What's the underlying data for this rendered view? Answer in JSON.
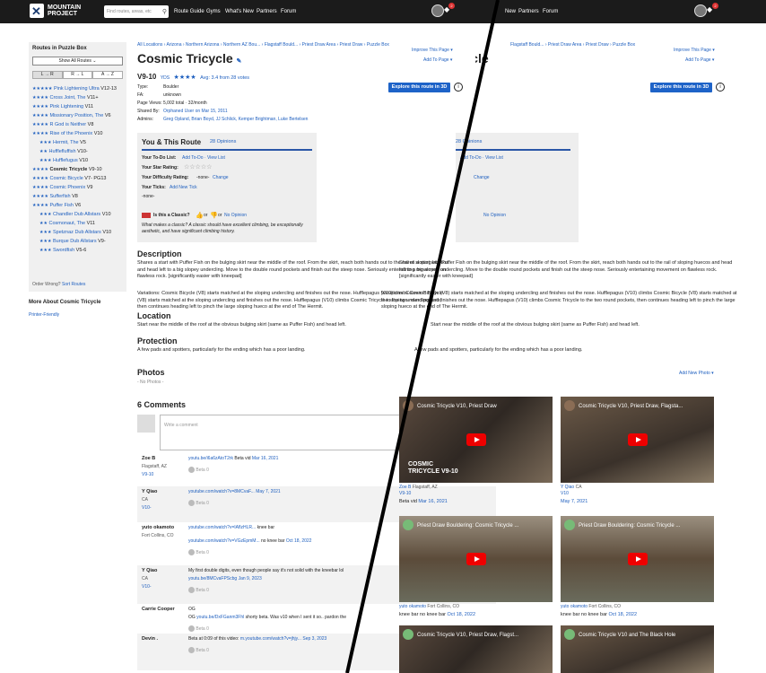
{
  "header": {
    "brand": [
      "MOUNTAIN",
      "PROJECT"
    ],
    "search_placeholder": "Find routes, areas, etc",
    "nav": [
      "Route Guide",
      "Gyms",
      "What's New",
      "Partners",
      "Forum"
    ],
    "nav_right": [
      "New",
      "Partners",
      "Forum"
    ],
    "notif_count": "2"
  },
  "sidebar": {
    "title": "Routes in Puzzle Box",
    "show_all": "Show All Routes",
    "sort_buttons": [
      "L → R",
      "R → L",
      "A → Z"
    ],
    "routes": [
      {
        "stars": "★★★★★",
        "name": "Pink Lightening Ultra",
        "grade": "V12-13"
      },
      {
        "stars": "★★★★",
        "name": "Cross Joint, The",
        "grade": "V11+"
      },
      {
        "stars": "★★★★",
        "name": "Pink Lightening",
        "grade": "V11"
      },
      {
        "stars": "★★★★",
        "name": "Missionary Position, The",
        "grade": "V6"
      },
      {
        "stars": "★★★★",
        "name": "R God is Neither",
        "grade": "V8"
      },
      {
        "stars": "★★★★",
        "name": "Rise of the Phoenix",
        "grade": "V10"
      },
      {
        "stars": "★★★",
        "name": "Hermit, The",
        "grade": "V5"
      },
      {
        "stars": "★★",
        "name": "Hufflefluffish",
        "grade": "V10-"
      },
      {
        "stars": "★★★",
        "name": "Hufflefugus",
        "grade": "V10"
      },
      {
        "stars": "★★★★",
        "name": "Cosmic Tricycle",
        "grade": "V9-10"
      },
      {
        "stars": "★★★★",
        "name": "Cosmic Bicycle",
        "grade": "V7- PG13"
      },
      {
        "stars": "★★★★",
        "name": "Cosmic Phoenix",
        "grade": "V9"
      },
      {
        "stars": "★★★★",
        "name": "Sufferfish",
        "grade": "V8"
      },
      {
        "stars": "★★★★",
        "name": "Puffer Fish",
        "grade": "V6"
      },
      {
        "stars": "★★★",
        "name": "Chandler Dub Allstars",
        "grade": "V10"
      },
      {
        "stars": "★★",
        "name": "Cosmonaut, The",
        "grade": "V11"
      },
      {
        "stars": "★★★",
        "name": "Spetznaz Dub Allstars",
        "grade": "V10"
      },
      {
        "stars": "★★★",
        "name": "Burque Dub Allstars",
        "grade": "V9-"
      },
      {
        "stars": "★★★",
        "name": "Swordfish",
        "grade": "V5-6"
      }
    ],
    "footer_text": "Order Wrong?",
    "footer_link": "Sort Routes",
    "more_about": "More About Cosmic Tricycle",
    "printer": "Printer-Friendly"
  },
  "breadcrumb": "All Locations › Arizona › Northern Arizona › Northern AZ Bou... › Flagstaff Bould... › Priest Draw Area › Priest Draw › Puzzle Box",
  "breadcrumb_right": "Flagstaff Bould... › Priest Draw Area › Priest Draw › Puzzle Box",
  "improve": "Improve This Page ▾",
  "add_to": "Add To Page ▾",
  "title": "Cosmic Tricycle",
  "grade": "V9-10",
  "grade_sys": "YDS",
  "rating": "★★★★",
  "avg": "Avg: 3.4 from 28 votes",
  "explore": "Explore this route in 3D",
  "info": {
    "labels": [
      "Type:",
      "FA:",
      "Page Views:",
      "Shared By:",
      "Admins:"
    ],
    "values": [
      "Boulder",
      "unknown",
      "5,002 total · 32/month",
      "Orphaned User on Mar 15, 2011",
      "Greg Opland, Brian Boyd, JJ Schlick, Kemper Brightman, Luke Bertelsen"
    ]
  },
  "you": {
    "title": "You & This Route",
    "opinions": "28 Opinions",
    "todo_label": "Your To-Do List:",
    "todo_link": "Add To-Do · View List",
    "star_label": "Your Star Rating:",
    "diff_label": "Your Difficulty Rating:",
    "diff_val": "-none-",
    "diff_link": "Change",
    "ticks_label": "Your Ticks:",
    "ticks_link": "Add New Tick",
    "ticks_val": "-none-",
    "classic_q": "Is this a Classic?",
    "or": "or",
    "no_opinion": "No Opinion",
    "classic_note": "What makes a classic? A classic should have excellent climbing, be exceptionally aesthetic, and have significant climbing history."
  },
  "description": {
    "heading": "Description",
    "p1": "Shares a start with Puffer Fish on the bulging skirt near the middle of the roof. From the skirt, reach both hands out to the rail of sloping huecos and head left to a big slopey undercling. Move to the double round pockets and finish out the steep nose. Seriously entertaining movement on flawless rock. [significantly easier with kneepad]",
    "p2": "Variations: Cosmic Bicycle (V8) starts matched at the sloping undercling and finishes out the nose. Hufflepagus (V10) climbs Cosmic Bicycle (V8) starts matched at the sloping undercling and finishes out the nose. Hufflepagus (V10) climbs Cosmic Tricycle to the two round pockets, then continues heading left to pinch the large sloping hueco at the end of The Hermit."
  },
  "location": {
    "heading": "Location",
    "text": "Start near the middle of the roof at the obvious bulging skirt (same as Puffer Fish) and head left."
  },
  "protection": {
    "heading": "Protection",
    "text": "A few pads and spotters, particularly for the ending which has a poor landing."
  },
  "photos": {
    "heading": "Photos",
    "none": "- No Photos -",
    "add": "Add New Photo ▾"
  },
  "comments": {
    "heading": "6 Comments",
    "placeholder": "Write a comment",
    "items": [
      {
        "user": "Zoe B",
        "loc": "Flagstaff, AZ",
        "grade": "V9-10",
        "link": "youtu.be/i6a6zAtoT2rk",
        "text": "Beta vid",
        "date": "Mar 16, 2021",
        "beta": "Beta 0"
      },
      {
        "user": "Y Qiao",
        "loc": "CA",
        "grade": "V10-",
        "link": "youtube.com/watch?v=8MCvaF...",
        "text": "",
        "date": "May 7, 2021",
        "beta": "Beta 0"
      },
      {
        "user": "yuto okamoto",
        "loc": "Fort Collins, CO",
        "grade": "",
        "link": "youtube.com/watch?v=IAflzHLR...",
        "text": "knee bar",
        "link2": "youtube.com/watch?v=VGzEpmM...",
        "text2": "no knee bar",
        "date": "Oct 18, 2022",
        "beta": "Beta 0"
      },
      {
        "user": "Y Qiao",
        "loc": "CA",
        "grade": "V10-",
        "text": "My first double digits, even though people say it's not solid with the kneebar lol",
        "link": "youtu.be/8MCvaFPScbg",
        "date": "Jan 9, 2023",
        "beta": "Beta 0"
      },
      {
        "user": "Carrie Cooper",
        "loc": "",
        "grade": "",
        "text": "OG",
        "link": "youtu.be/DxFGanm3Fhl",
        "text2": "shorty beta. Was v10 when I sent it so.. pardon the",
        "beta": "Beta 0"
      },
      {
        "user": "Devin .",
        "loc": "",
        "grade": "",
        "text": "Beta at 0:09 of this video:",
        "link": "m.youtube.com/watch?v=jhjy...",
        "date": "Sep 3, 2023",
        "beta": "Beta 0"
      }
    ]
  },
  "videos": [
    {
      "title": "Cosmic Tricycle V10, Priest Draw",
      "overlay": "COSMIC TRICYCLE V9-10",
      "user": "Zoe B",
      "loc": "Flagstaff, AZ",
      "grade": "V9-10",
      "caption": "Beta vid",
      "date": "Mar 16, 2021"
    },
    {
      "title": "Cosmic Tricycle V10, Priest Draw, Flagsta...",
      "user": "Y Qiao",
      "loc": "CA",
      "grade": "V10",
      "caption": "",
      "date": "May 7, 2021"
    },
    {
      "title": "Priest Draw Bouldering: Cosmic Tricycle ...",
      "user": "yuto okamoto",
      "loc": "Fort Collins, CO",
      "caption": "knee bar no knee bar",
      "date": "Oct 18, 2022"
    },
    {
      "title": "Priest Draw Bouldering: Cosmic Tricycle ...",
      "user": "yuto okamoto",
      "loc": "Fort Collins, CO",
      "caption": "knee bar no knee bar",
      "date": "Oct 18, 2022"
    },
    {
      "title": "Cosmic Tricycle V10, Priest Draw, Flagst...",
      "user": "",
      "caption": "",
      "date": ""
    },
    {
      "title": "Cosmic Tricycle V10 and The Black Hole",
      "user": "",
      "caption": "",
      "date": ""
    }
  ],
  "colors": {
    "header": "#1b1b1b",
    "accent": "#1e63c8",
    "link": "#1e5fbf"
  }
}
